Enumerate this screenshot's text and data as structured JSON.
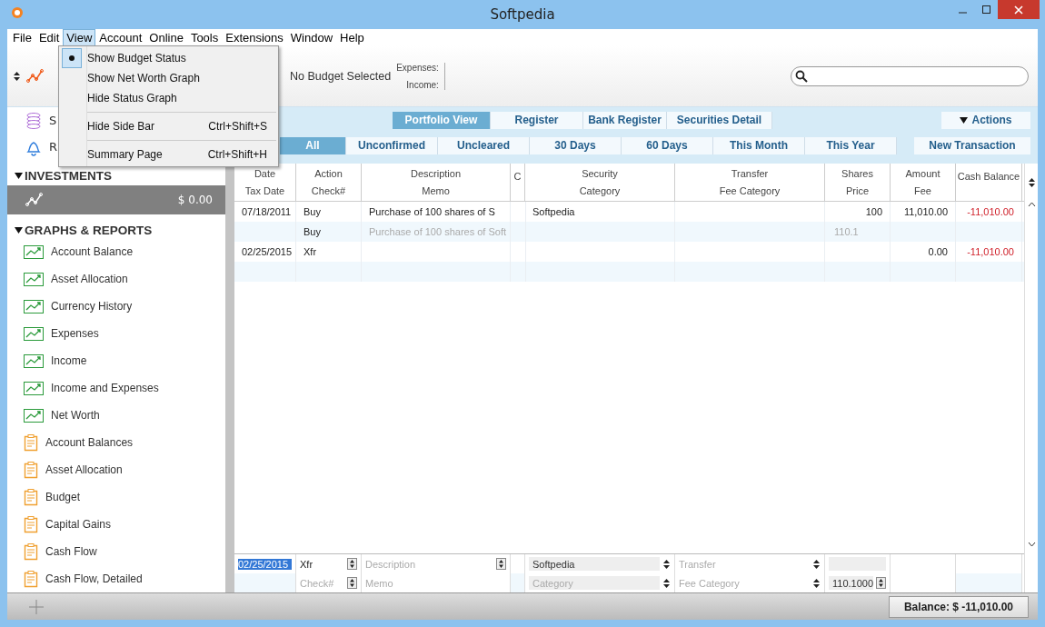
{
  "window": {
    "title": "Softpedia"
  },
  "menu_bar": [
    {
      "label": "File",
      "selected": false
    },
    {
      "label": "Edit",
      "selected": false
    },
    {
      "label": "View",
      "selected": true
    },
    {
      "label": "Account",
      "selected": false
    },
    {
      "label": "Online",
      "selected": false
    },
    {
      "label": "Tools",
      "selected": false
    },
    {
      "label": "Extensions",
      "selected": false
    },
    {
      "label": "Window",
      "selected": false
    },
    {
      "label": "Help",
      "selected": false
    }
  ],
  "view_menu": [
    {
      "label": "Show Budget Status",
      "checked": true,
      "separator_before": false
    },
    {
      "label": "Show Net Worth Graph",
      "checked": false,
      "separator_before": false
    },
    {
      "label": "Hide Status Graph",
      "checked": false,
      "separator_before": false
    },
    {
      "label": "Hide Side Bar",
      "shortcut": "Ctrl+Shift+S",
      "checked": false,
      "separator_before": true
    },
    {
      "label": "Summary Page",
      "shortcut": "Ctrl+Shift+H",
      "checked": false,
      "separator_before": true
    }
  ],
  "toolbar": {
    "budget": "No Budget Selected",
    "expenses_label": "Expenses:",
    "income_label": "Income:"
  },
  "sidebar": {
    "top_items": [
      {
        "kind": "coins",
        "label": "S"
      },
      {
        "kind": "bell",
        "label": "R"
      }
    ],
    "sections": [
      {
        "title": "INVESTMENTS",
        "expanded": true,
        "items": [
          {
            "kind": "account",
            "amount": "$ 0.00",
            "selected": true
          }
        ]
      },
      {
        "title": "GRAPHS & REPORTS",
        "expanded": true,
        "items": [
          {
            "kind": "graph",
            "label": "Account Balance",
            "selected": false
          },
          {
            "kind": "graph",
            "label": "Asset Allocation",
            "selected": false
          },
          {
            "kind": "graph",
            "label": "Currency History",
            "selected": false
          },
          {
            "kind": "graph",
            "label": "Expenses",
            "selected": false
          },
          {
            "kind": "graph",
            "label": "Income",
            "selected": false
          },
          {
            "kind": "graph",
            "label": "Income and Expenses",
            "selected": false
          },
          {
            "kind": "graph",
            "label": "Net Worth",
            "selected": false
          },
          {
            "kind": "report",
            "label": "Account Balances",
            "selected": false
          },
          {
            "kind": "report",
            "label": "Asset Allocation",
            "selected": false
          },
          {
            "kind": "report",
            "label": "Budget",
            "selected": false
          },
          {
            "kind": "report",
            "label": "Capital Gains",
            "selected": false
          },
          {
            "kind": "report",
            "label": "Cash Flow",
            "selected": false
          },
          {
            "kind": "report",
            "label": "Cash Flow, Detailed",
            "selected": false
          }
        ]
      }
    ]
  },
  "view_tabs": [
    {
      "label": "Portfolio View",
      "selected": true
    },
    {
      "label": "Register",
      "selected": false
    },
    {
      "label": "Bank Register",
      "selected": false
    },
    {
      "label": "Securities Detail",
      "selected": false
    }
  ],
  "actions_button": "Actions",
  "filter_tabs": [
    {
      "label": "All",
      "selected": true
    },
    {
      "label": "Unconfirmed",
      "selected": false
    },
    {
      "label": "Uncleared",
      "selected": false
    },
    {
      "label": "30 Days",
      "selected": false
    },
    {
      "label": "60 Days",
      "selected": false
    },
    {
      "label": "This Month",
      "selected": false
    },
    {
      "label": "This Year",
      "selected": false
    }
  ],
  "new_transaction_button": "New Transaction",
  "table": {
    "columns": [
      {
        "top": "Date",
        "bottom": "Tax Date"
      },
      {
        "top": "Action",
        "bottom": "Check#"
      },
      {
        "top": "Description",
        "bottom": "Memo"
      },
      {
        "top": "C"
      },
      {
        "top": "Security",
        "bottom": "Category"
      },
      {
        "top": "Transfer",
        "bottom": "Fee Category"
      },
      {
        "top": "Shares",
        "bottom": "Price"
      },
      {
        "top": "Amount",
        "bottom": "Fee"
      },
      {
        "top": "Cash Balance"
      }
    ],
    "rows": [
      {
        "date": "07/18/2011",
        "action": "Buy",
        "description": "Purchase of 100 shares of S",
        "security": "Softpedia",
        "shares": "100",
        "amount": "11,010.00",
        "cash_balance": "-11,010.00",
        "negative": true,
        "check": "Buy",
        "memo": "Purchase of 100 shares of Soft",
        "price": "110.1"
      },
      {
        "date": "02/25/2015",
        "action": "Xfr",
        "amount": "0.00",
        "cash_balance": "-11,010.00",
        "negative": true
      }
    ]
  },
  "entry": {
    "date": "02/25/2015",
    "action": "Xfr",
    "description_placeholder": "Description",
    "check_placeholder": "Check#",
    "memo_placeholder": "Memo",
    "security": "Softpedia",
    "category_placeholder": "Category",
    "transfer_placeholder": "Transfer",
    "fee_category_placeholder": "Fee Category",
    "price": "110.1000"
  },
  "status_bar": {
    "balance": "Balance: $ -11,010.00"
  }
}
